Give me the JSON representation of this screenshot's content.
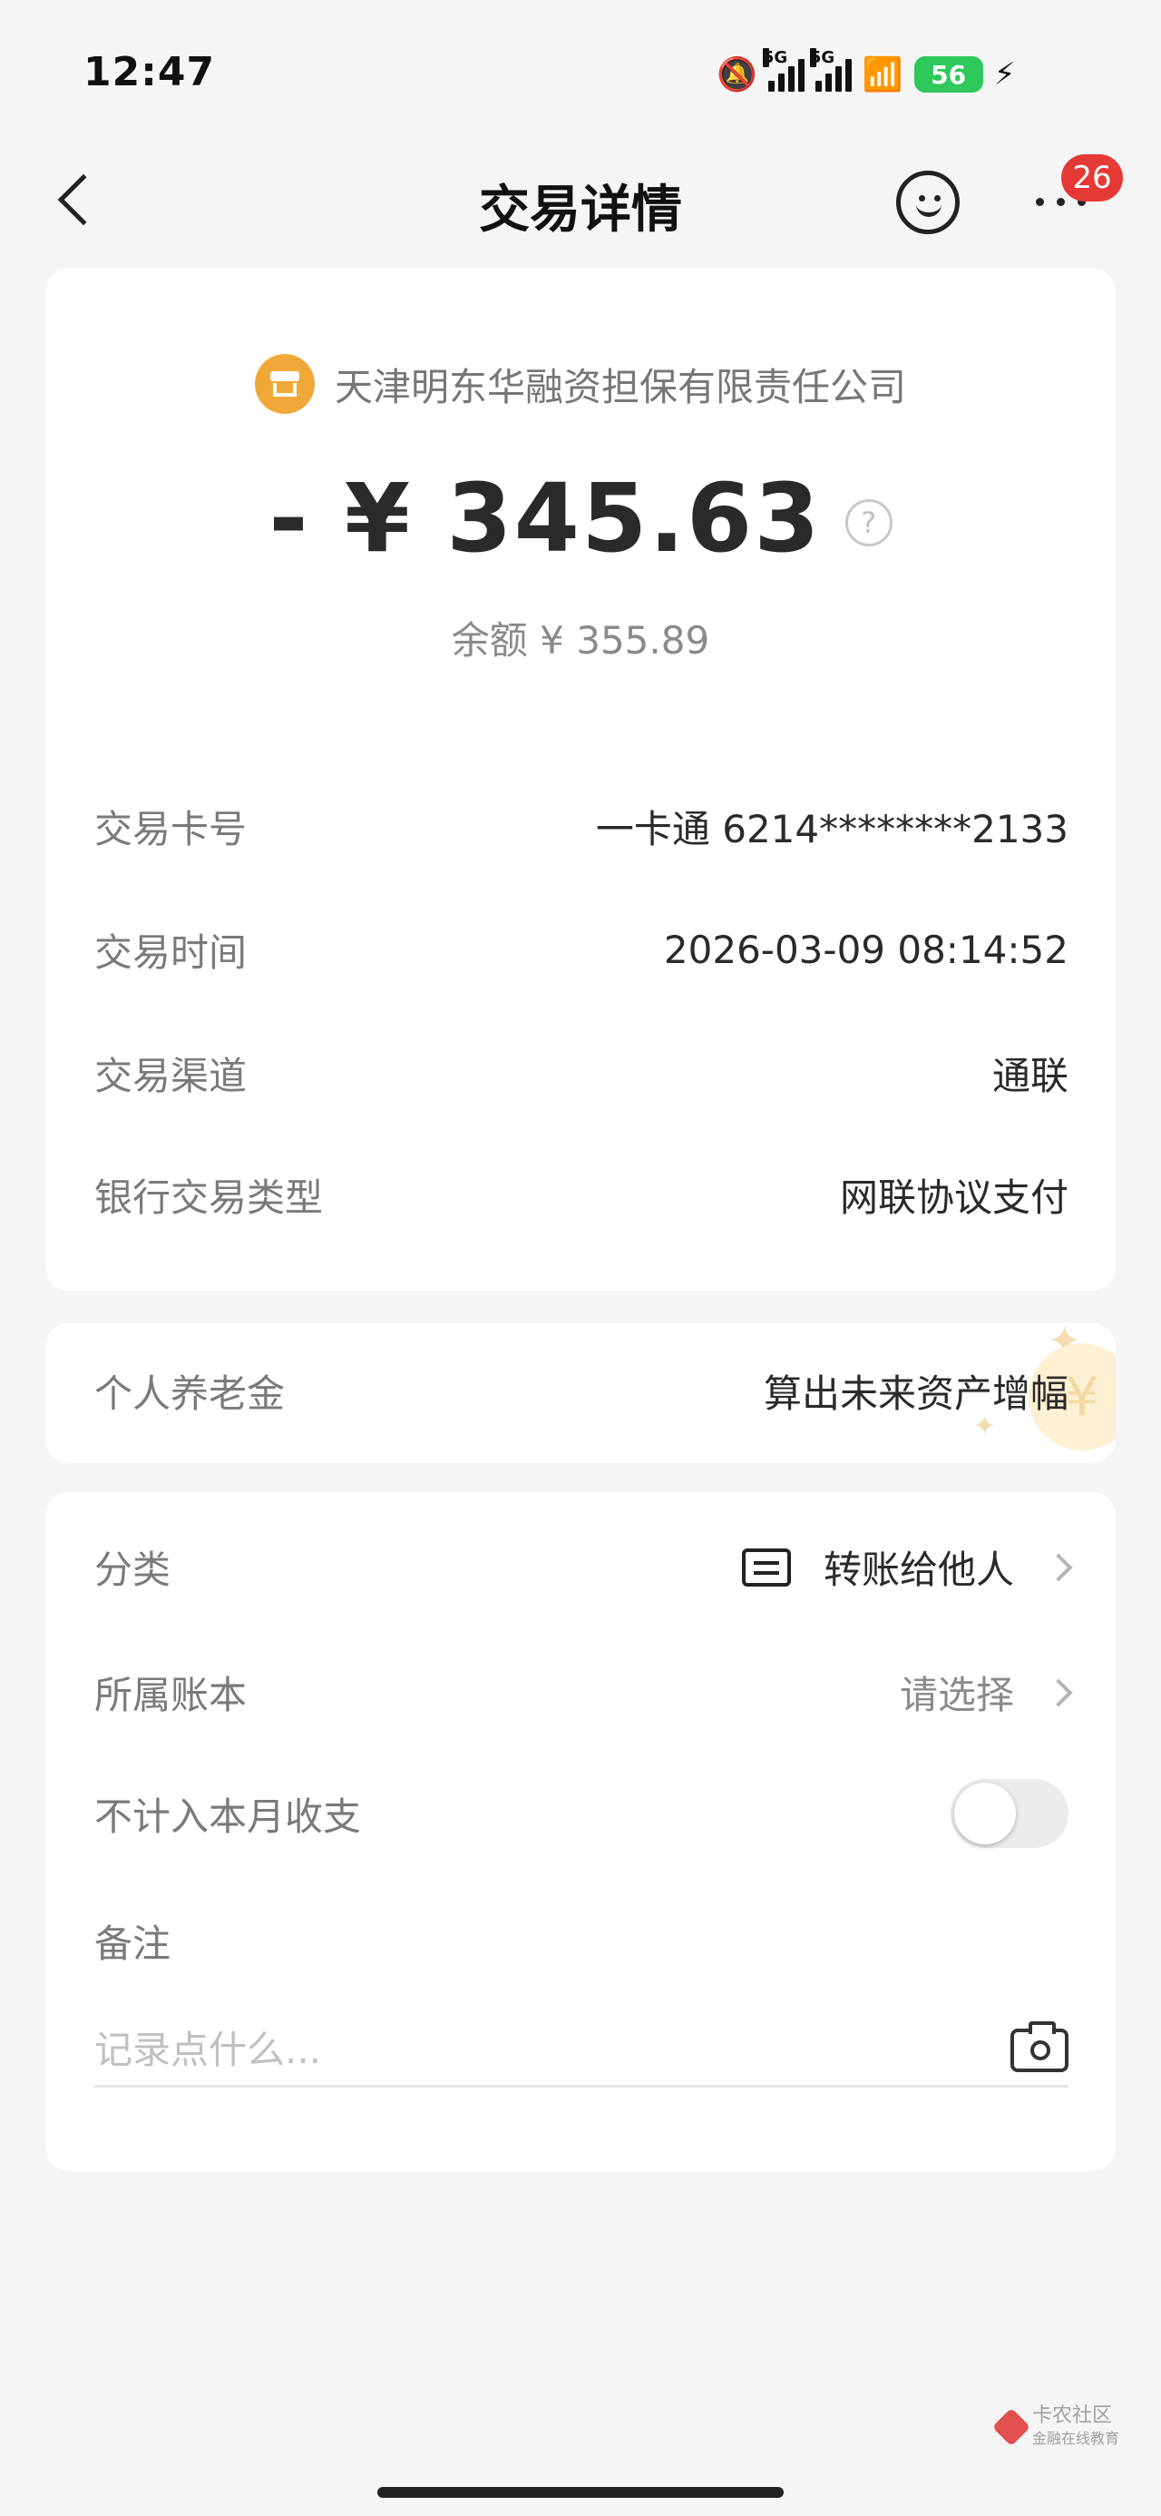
{
  "status_bar": {
    "time": "12:47",
    "network_tag": "5G",
    "battery": "56"
  },
  "header": {
    "title": "交易详情",
    "badge_count": "26"
  },
  "transaction": {
    "merchant": "天津明东华融资担保有限责任公司",
    "amount": "- ¥ 345.63",
    "balance": "余额 ¥ 355.89",
    "help_glyph": "?",
    "details": [
      {
        "label": "交易卡号",
        "value": "一卡通 6214********2133"
      },
      {
        "label": "交易时间",
        "value": "2026-03-09 08:14:52"
      },
      {
        "label": "交易渠道",
        "value": "通联"
      },
      {
        "label": "银行交易类型",
        "value": "网联协议支付"
      }
    ]
  },
  "pension": {
    "label": "个人养老金",
    "value": "算出未来资产增幅",
    "coin_glyph": "¥"
  },
  "settings": {
    "category_label": "分类",
    "category_value": "转账给他人",
    "ledger_label": "所属账本",
    "ledger_value": "请选择",
    "exclude_label": "不计入本月收支",
    "exclude_enabled": false,
    "note_label": "备注",
    "note_placeholder": "记录点什么...",
    "note_value": ""
  },
  "watermark": {
    "line1": "卡农社区",
    "line2": "金融在线教育"
  },
  "colors": {
    "merchant_icon": "#f0a938",
    "badge": "#e53935",
    "battery": "#2fc85a",
    "background": "#f5f5f5"
  },
  "icons": [
    "back-icon",
    "face-icon",
    "more-icon",
    "merchant-icon",
    "help-icon",
    "transfer-icon",
    "chevron-right-icon",
    "camera-icon"
  ]
}
